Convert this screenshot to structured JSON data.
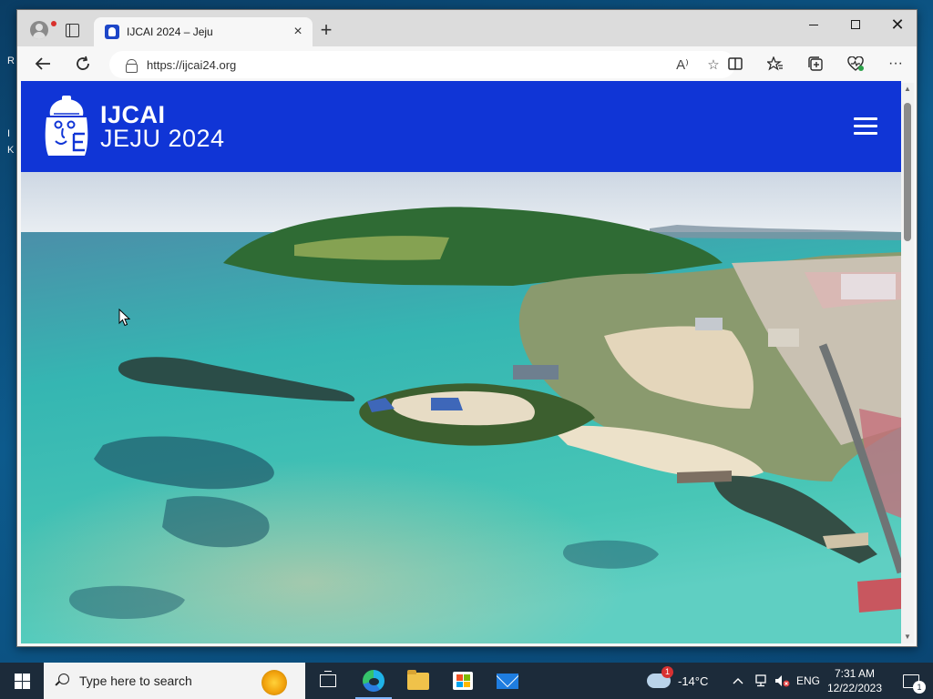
{
  "browser": {
    "tab_title": "IJCAI 2024 – Jeju",
    "url": "https://ijcai24.org",
    "read_aloud_glyph": "A⁾"
  },
  "site": {
    "brand_line1": "IJCAI",
    "brand_line2": "JEJU 2024",
    "brand_color": "#1035d6"
  },
  "taskbar": {
    "search_placeholder": "Type here to search",
    "weather_temp": "-14°C",
    "weather_badge": "1",
    "language": "ENG",
    "time": "7:31 AM",
    "date": "12/22/2023",
    "notification_count": "1"
  },
  "desktop": {
    "icon_label_fragments": [
      "R",
      "I",
      "K"
    ]
  }
}
